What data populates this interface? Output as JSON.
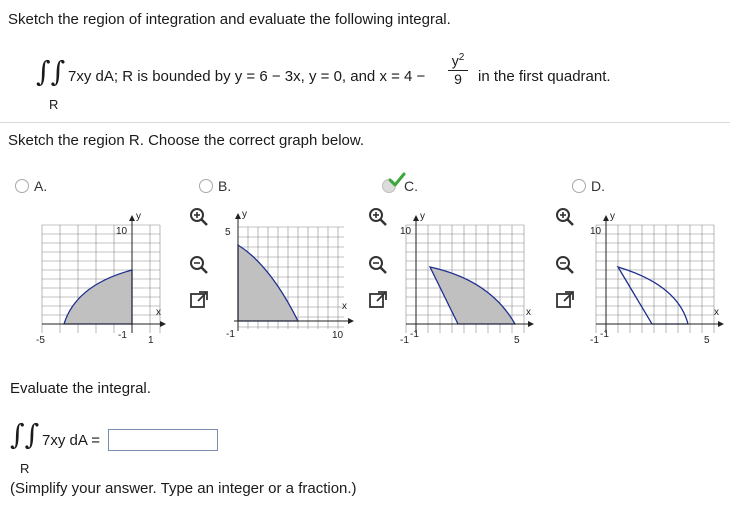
{
  "problem": {
    "instruction": "Sketch the region of integration and evaluate the following integral.",
    "integrand": "7xy dA; R is bounded by y = 6 − 3x, y = 0, and x = 4 −",
    "frac_num": "y",
    "frac_exp": "2",
    "frac_den": "9",
    "suffix": "in the first quadrant.",
    "region_sub": "R"
  },
  "sketch": {
    "prompt": "Sketch the region R. Choose the correct graph below."
  },
  "options": [
    {
      "letter": "A.",
      "selected": false,
      "ticks": {
        "top": "10",
        "left": "-5",
        "right": "1",
        "bottom": "-1"
      },
      "axis_x": "x",
      "axis_y": "y"
    },
    {
      "letter": "B.",
      "selected": false,
      "ticks": {
        "top": "5",
        "left": "",
        "right": "10",
        "bottom": "-1"
      },
      "axis_x": "x",
      "axis_y": "y"
    },
    {
      "letter": "C.",
      "selected": true,
      "ticks": {
        "top": "10",
        "left": "-1",
        "right": "5",
        "bottom": "-1"
      },
      "axis_x": "x",
      "axis_y": "y"
    },
    {
      "letter": "D.",
      "selected": false,
      "ticks": {
        "top": "10",
        "left": "-1",
        "right": "5",
        "bottom": "-1"
      },
      "axis_x": "x",
      "axis_y": "y"
    }
  ],
  "evaluate": {
    "prompt": "Evaluate the integral.",
    "integrand": "7xy dA =",
    "region_sub": "R",
    "answer_value": "",
    "hint": "(Simplify your answer. Type an integer or a fraction.)"
  },
  "colors": {
    "region_fill": "#c0c0c0",
    "boundary": "#1f2f8f",
    "grid": "#888888",
    "check": "#3aa83a"
  },
  "icons": [
    "zoom-in-icon",
    "zoom-out-icon",
    "expand-icon",
    "checkmark-icon"
  ]
}
